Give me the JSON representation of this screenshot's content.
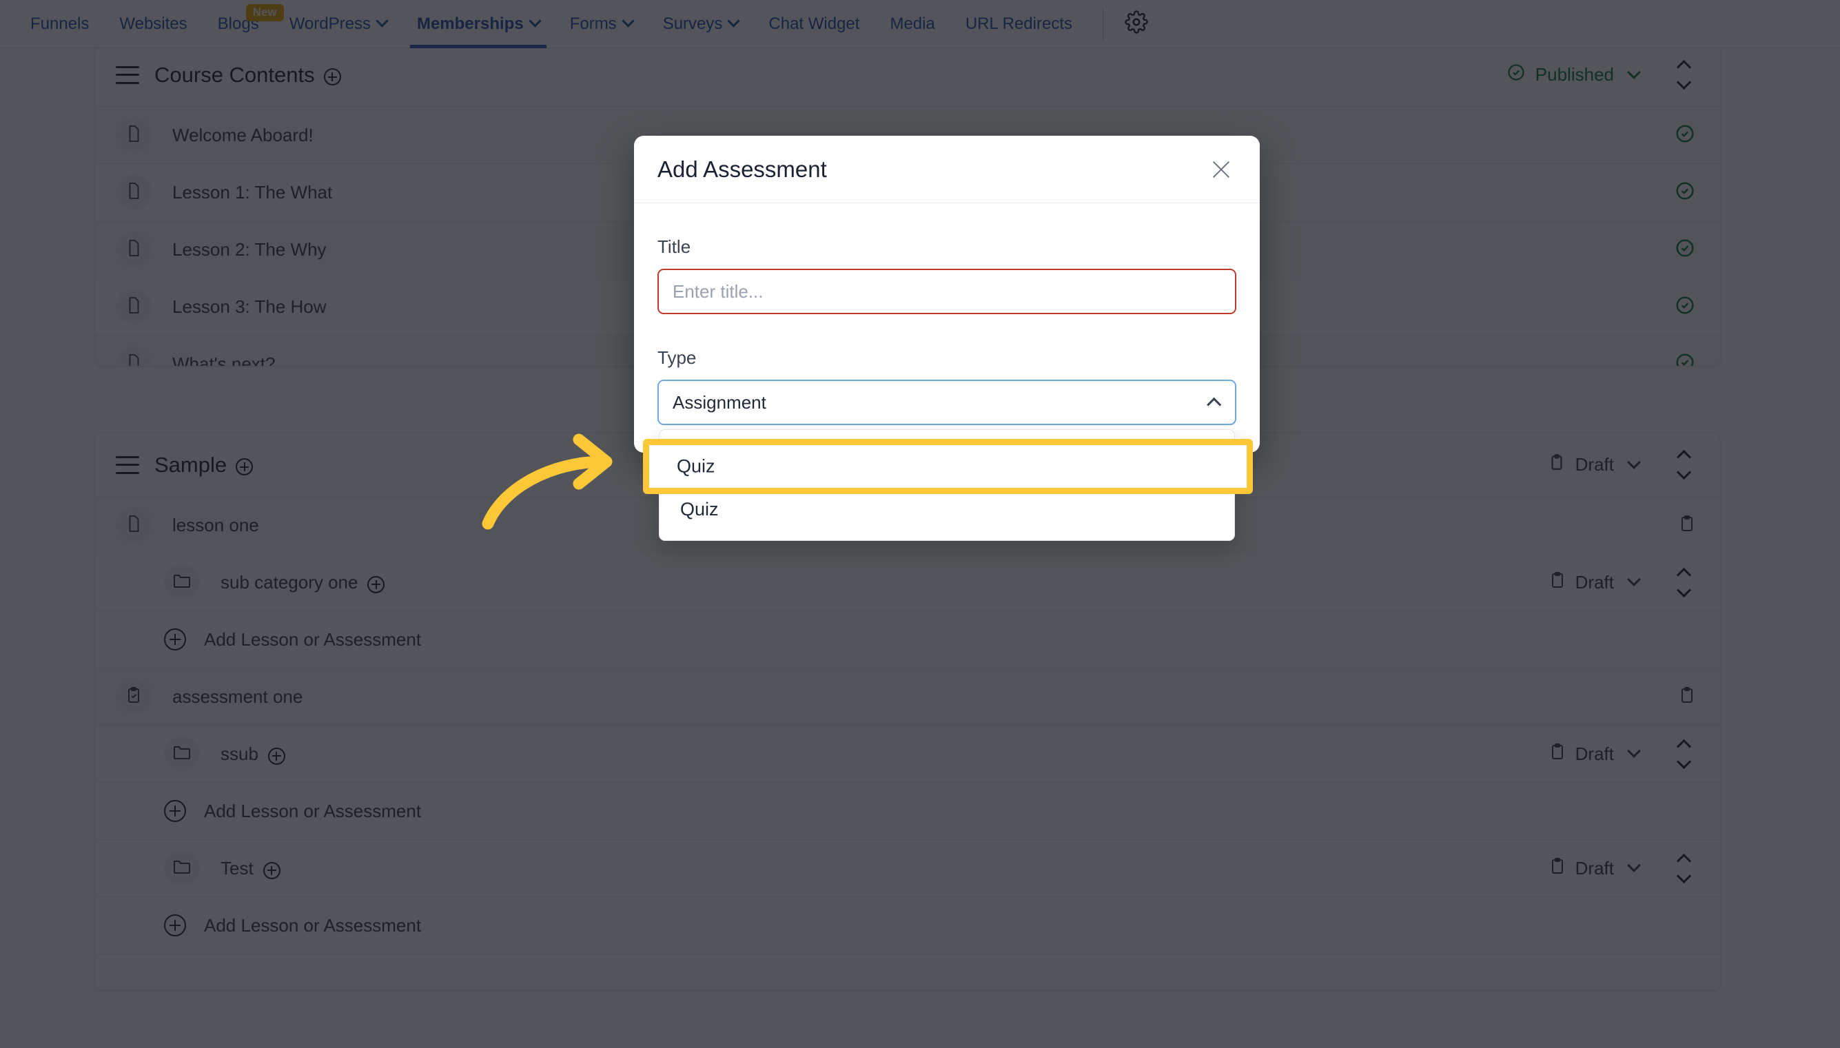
{
  "topnav": {
    "items": [
      {
        "label": "Funnels",
        "has_chevron": false,
        "active": false,
        "badge": null
      },
      {
        "label": "Websites",
        "has_chevron": false,
        "active": false,
        "badge": null
      },
      {
        "label": "Blogs",
        "has_chevron": false,
        "active": false,
        "badge": "New"
      },
      {
        "label": "WordPress",
        "has_chevron": true,
        "active": false,
        "badge": null
      },
      {
        "label": "Memberships",
        "has_chevron": true,
        "active": true,
        "badge": null
      },
      {
        "label": "Forms",
        "has_chevron": true,
        "active": false,
        "badge": null
      },
      {
        "label": "Surveys",
        "has_chevron": true,
        "active": false,
        "badge": null
      },
      {
        "label": "Chat Widget",
        "has_chevron": false,
        "active": false,
        "badge": null
      },
      {
        "label": "Media",
        "has_chevron": false,
        "active": false,
        "badge": null
      },
      {
        "label": "URL Redirects",
        "has_chevron": false,
        "active": false,
        "badge": null
      }
    ],
    "settings_icon": "gear-icon",
    "accent_color": "#2852a8",
    "badge_color": "#f0ab00"
  },
  "sections": [
    {
      "title": "Course Contents",
      "status": {
        "label": "Published",
        "icon": "check-circle-icon",
        "color": "#1e7a43"
      },
      "rows": [
        {
          "label": "Welcome Aboard!",
          "icon": "document-icon",
          "right_icon": "check-circle-icon"
        },
        {
          "label": "Lesson 1: The What",
          "icon": "document-icon",
          "right_icon": "check-circle-icon"
        },
        {
          "label": "Lesson 2: The Why",
          "icon": "document-icon",
          "right_icon": "check-circle-icon"
        },
        {
          "label": "Lesson 3: The How",
          "icon": "document-icon",
          "right_icon": "check-circle-icon"
        },
        {
          "label": "What's next?",
          "icon": "document-icon",
          "right_icon": "check-circle-icon"
        }
      ]
    },
    {
      "title": "Sample",
      "status": {
        "label": "Draft",
        "icon": "clipboard-icon",
        "color": "#3b4251"
      },
      "rows": [
        {
          "type": "lesson",
          "label": "lesson one",
          "icon": "document-icon",
          "right_icon": "clipboard-icon",
          "status": null
        },
        {
          "type": "category",
          "label": "sub category one",
          "icon": "folder-icon",
          "right_icon": null,
          "status": "Draft"
        },
        {
          "type": "add",
          "label": "Add Lesson or Assessment",
          "icon": "plus-circle-icon",
          "right_icon": null,
          "status": null
        },
        {
          "type": "assessment",
          "label": "assessment one",
          "icon": "clipboard-check-icon",
          "right_icon": "clipboard-icon",
          "status": null
        },
        {
          "type": "category",
          "label": "ssub",
          "icon": "folder-icon",
          "right_icon": null,
          "status": "Draft"
        },
        {
          "type": "add",
          "label": "Add Lesson or Assessment",
          "icon": "plus-circle-icon",
          "right_icon": null,
          "status": null
        },
        {
          "type": "category",
          "label": "Test",
          "icon": "folder-icon",
          "right_icon": null,
          "status": "Draft"
        },
        {
          "type": "add",
          "label": "Add Lesson or Assessment",
          "icon": "plus-circle-icon",
          "right_icon": null,
          "status": null
        }
      ]
    }
  ],
  "modal": {
    "title": "Add Assessment",
    "close_icon": "close-icon",
    "title_field": {
      "label": "Title",
      "value": "",
      "placeholder": "Enter title...",
      "error": true
    },
    "type_field": {
      "label": "Type",
      "selected": "Assignment",
      "expanded": true,
      "options": [
        "Assignment",
        "Quiz"
      ]
    }
  },
  "annotation": {
    "highlight_option": "Quiz",
    "highlight_color": "#fcc837",
    "arrow_icon": "curved-arrow-icon"
  }
}
